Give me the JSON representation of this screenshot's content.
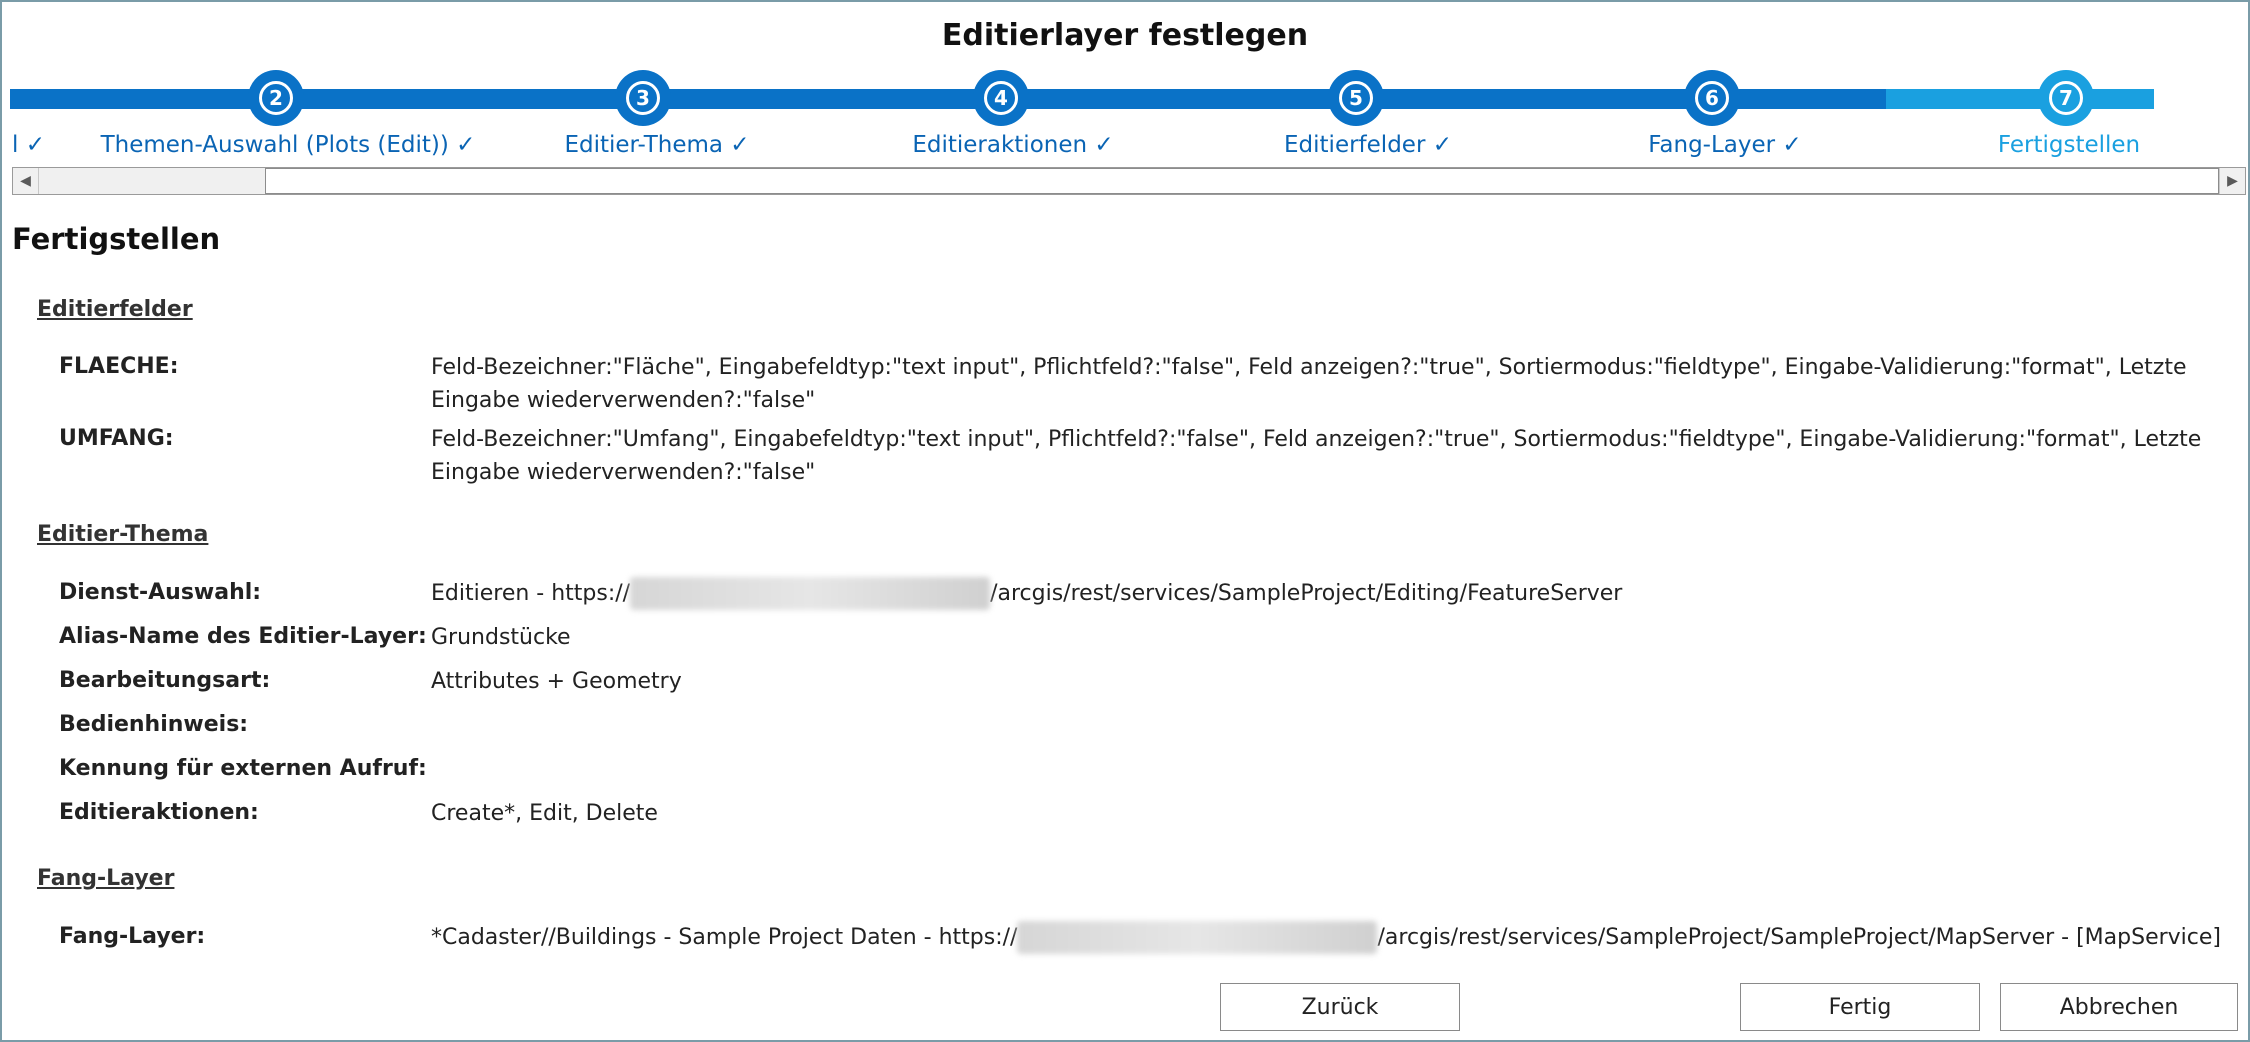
{
  "dialog": {
    "title": "Editierlayer festlegen"
  },
  "stepper": {
    "first_partial_label": "l ✓",
    "steps": [
      {
        "number": "2",
        "label": "Themen-Auswahl (Plots (Edit)) ✓"
      },
      {
        "number": "3",
        "label": "Editier-Thema ✓"
      },
      {
        "number": "4",
        "label": "Editieraktionen ✓"
      },
      {
        "number": "5",
        "label": "Editierfelder ✓"
      },
      {
        "number": "6",
        "label": "Fang-Layer ✓"
      },
      {
        "number": "7",
        "label": "Fertigstellen"
      }
    ],
    "colors": {
      "done": "#0a72c7",
      "current": "#1aa0e0"
    }
  },
  "scrollbar": {
    "left_icon": "scroll-left-arrow-icon",
    "right_icon": "scroll-right-arrow-icon"
  },
  "content": {
    "heading": "Fertigstellen",
    "editierfelder": {
      "title": "Editierfelder",
      "rows": [
        {
          "label": "FLAECHE:",
          "value": "Feld-Bezeichner:\"Fläche\", Eingabefeldtyp:\"text input\", Pflichtfeld?:\"false\", Feld anzeigen?:\"true\", Sortiermodus:\"fieldtype\", Eingabe-Validierung:\"format\", Letzte Eingabe wiederverwenden?:\"false\""
        },
        {
          "label": "UMFANG:",
          "value": "Feld-Bezeichner:\"Umfang\", Eingabefeldtyp:\"text input\", Pflichtfeld?:\"false\", Feld anzeigen?:\"true\", Sortiermodus:\"fieldtype\", Eingabe-Validierung:\"format\", Letzte Eingabe wiederverwenden?:\"false\""
        }
      ]
    },
    "editier_thema": {
      "title": "Editier-Thema",
      "dienst_label": "Dienst-Auswahl:",
      "dienst_prefix": "Editieren - https://",
      "dienst_suffix": "/arcgis/rest/services/SampleProject/Editing/FeatureServer",
      "alias_label": "Alias-Name des Editier-Layer:",
      "alias_value": "Grundstücke",
      "bearbeitung_label": "Bearbeitungsart:",
      "bearbeitung_value": "Attributes + Geometry",
      "hinweis_label": "Bedienhinweis:",
      "kennung_label": "Kennung für externen Aufruf:",
      "aktionen_label": "Editieraktionen:",
      "aktionen_value": "Create*, Edit, Delete"
    },
    "fang_layer": {
      "title": "Fang-Layer",
      "label": "Fang-Layer:",
      "prefix": "*Cadaster//Buildings - Sample Project Daten - https://",
      "suffix": "/arcgis/rest/services/SampleProject/SampleProject/MapServer - [MapService]"
    }
  },
  "footer": {
    "back_label": "Zurück",
    "finish_label": "Fertig",
    "cancel_label": "Abbrechen"
  }
}
